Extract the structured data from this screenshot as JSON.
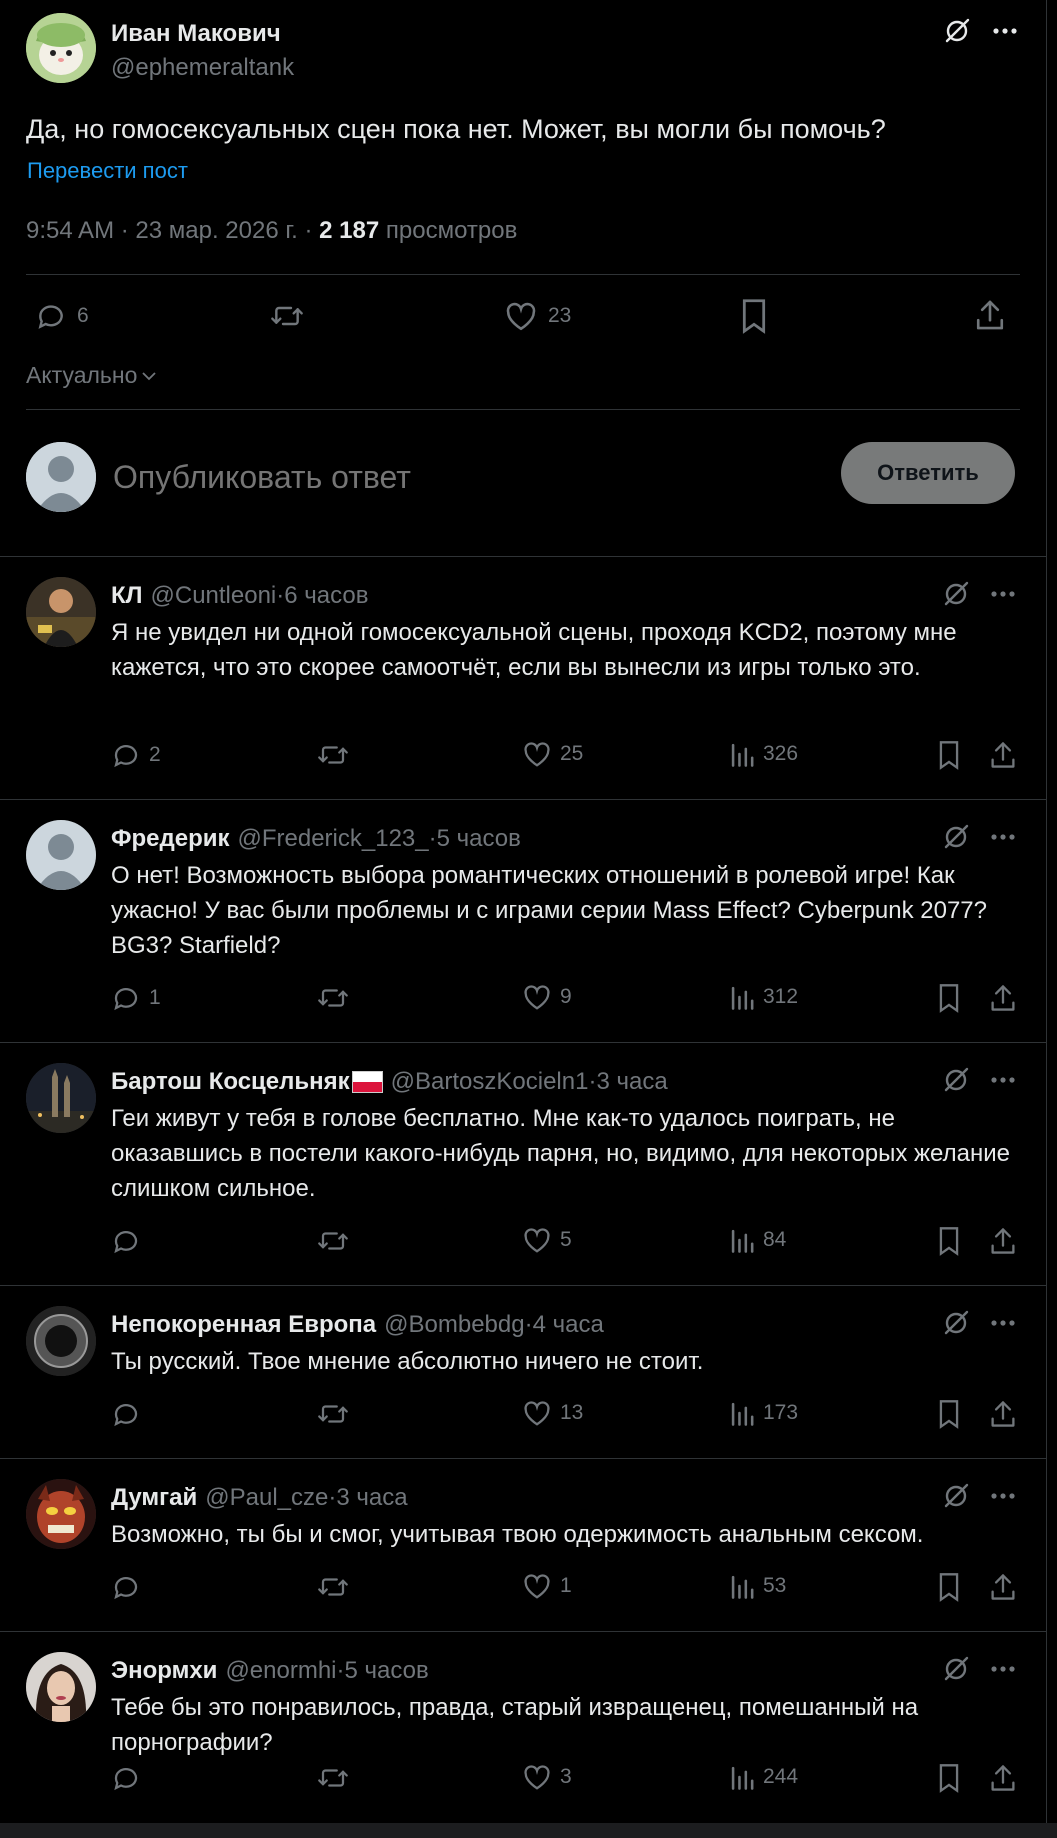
{
  "post": {
    "author_name": "Иван Макович",
    "author_handle": "@ephemeraltank",
    "text": "Да, но гомосексуальных сцен пока нет. Может, вы могли бы помочь?",
    "translate_label": "Перевести пост",
    "time": "9:54 AM · 23 мар. 2026 г. · ",
    "views_count": "2 187",
    "views_label": " просмотров",
    "replies": "6",
    "likes": "23",
    "sort_label": "Актуально"
  },
  "composer": {
    "placeholder": "Опубликовать ответ",
    "button_label": "Ответить"
  },
  "replies": [
    {
      "name": "КЛ",
      "handle": "@Cuntleoni",
      "time": "6 часов",
      "text": "Я не увидел ни одной гомосексуальной сцены, проходя KCD2, поэтому мне кажется, что это скорее самоотчёт, если вы вынесли из игры только это.",
      "replies": "2",
      "likes": "25",
      "views": "326"
    },
    {
      "name": "Фредерик",
      "handle": "@Frederick_123_",
      "time": "5 часов",
      "text": "О нет! Возможность выбора романтических отношений в ролевой игре! Как ужасно! У вас были проблемы и с играми серии Mass Effect? Cyberpunk 2077? BG3? Starfield?",
      "replies": "1",
      "likes": "9",
      "views": "312"
    },
    {
      "name": "Бартош Косцельняк",
      "handle": "@BartoszKocieln1",
      "time": "3 часа",
      "text": "Геи живут у тебя в голове бесплатно. Мне как-то удалось поиграть, не оказавшись в постели какого-нибудь парня, но, видимо, для некоторых желание слишком сильное.",
      "replies": "",
      "likes": "5",
      "views": "84"
    },
    {
      "name": "Непокоренная Европа",
      "handle": "@Bombebdg",
      "time": "4 часа",
      "text": "Ты русский. Твое мнение абсолютно ничего не стоит.",
      "replies": "",
      "likes": "13",
      "views": "173"
    },
    {
      "name": "Думгай",
      "handle": "@Paul_cze",
      "time": "3 часа",
      "text": "Возможно, ты бы и смог, учитывая твою одержимость анальным сексом.",
      "replies": "",
      "likes": "1",
      "views": "53"
    },
    {
      "name": "Энормхи",
      "handle": "@enormhi",
      "time": "5 часов",
      "text": "Тебе бы это понравилось, правда, старый извращенец, помешанный на порнографии?",
      "replies": "",
      "likes": "3",
      "views": "244"
    }
  ],
  "separator": " · ",
  "icons": [
    "grok-icon",
    "more-icon",
    "reply-icon",
    "repost-icon",
    "like-icon",
    "bookmark-icon",
    "share-icon",
    "views-icon",
    "chevron-down-icon"
  ],
  "colors": {
    "background": "#000000",
    "text": "#e7e9ea",
    "secondary": "#71767b",
    "link": "#1d9bf0",
    "divider": "#2f3336",
    "reply_button": "#787a7a"
  }
}
